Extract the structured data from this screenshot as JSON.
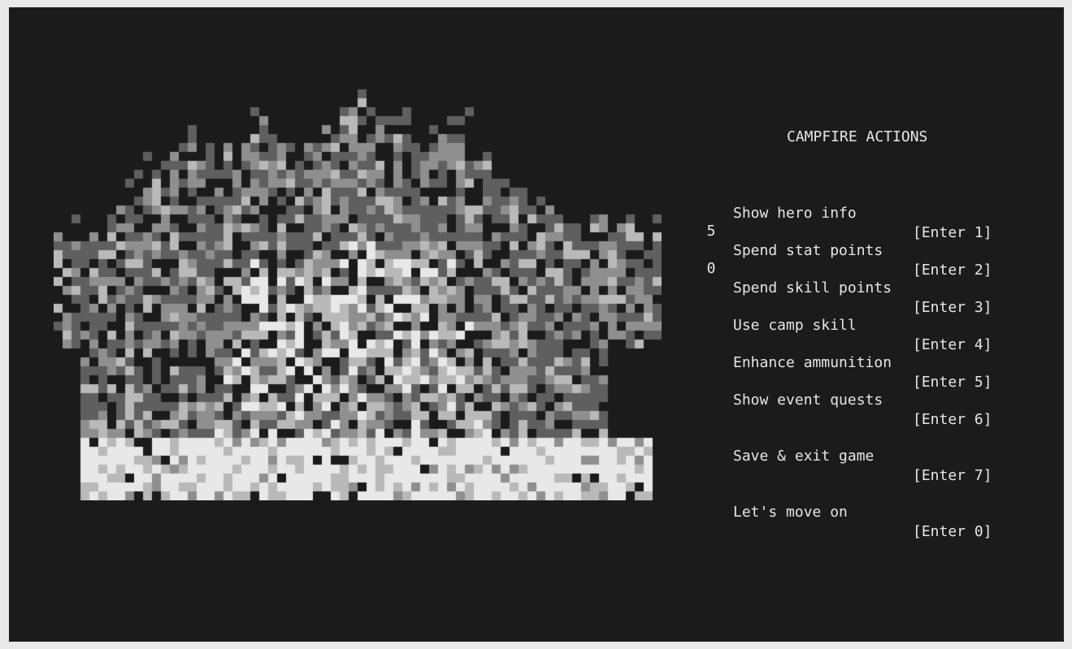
{
  "title": "CAMPFIRE ACTIONS",
  "menu": [
    {
      "count": "",
      "label": "Show hero info",
      "key": "[Enter 1]"
    },
    {
      "count": "5",
      "label": "Spend stat points",
      "key": "[Enter 2]"
    },
    {
      "count": "0",
      "label": "Spend skill points",
      "key": "[Enter 3]"
    },
    {
      "count": "",
      "label": "Use camp skill",
      "key": "[Enter 4]"
    },
    {
      "count": "",
      "label": "Enhance ammunition",
      "key": "[Enter 5]"
    },
    {
      "count": "",
      "label": "Show event quests",
      "key": "[Enter 6]"
    },
    {
      "count": "",
      "label": "Save & exit game",
      "key": "[Enter 7]"
    },
    {
      "count": "",
      "label": "Let's move on",
      "key": "[Enter 0]"
    }
  ],
  "colors": {
    "background": "#1b1b1b",
    "text": "#e6e6e6",
    "frame": "#e9e9e9",
    "fire_palette": [
      "#1b1b1b",
      "#e8e8e8",
      "#b9b9b9",
      "#8f8f8f",
      "#5f5f5f"
    ]
  },
  "icon": "campfire-pixel-art"
}
